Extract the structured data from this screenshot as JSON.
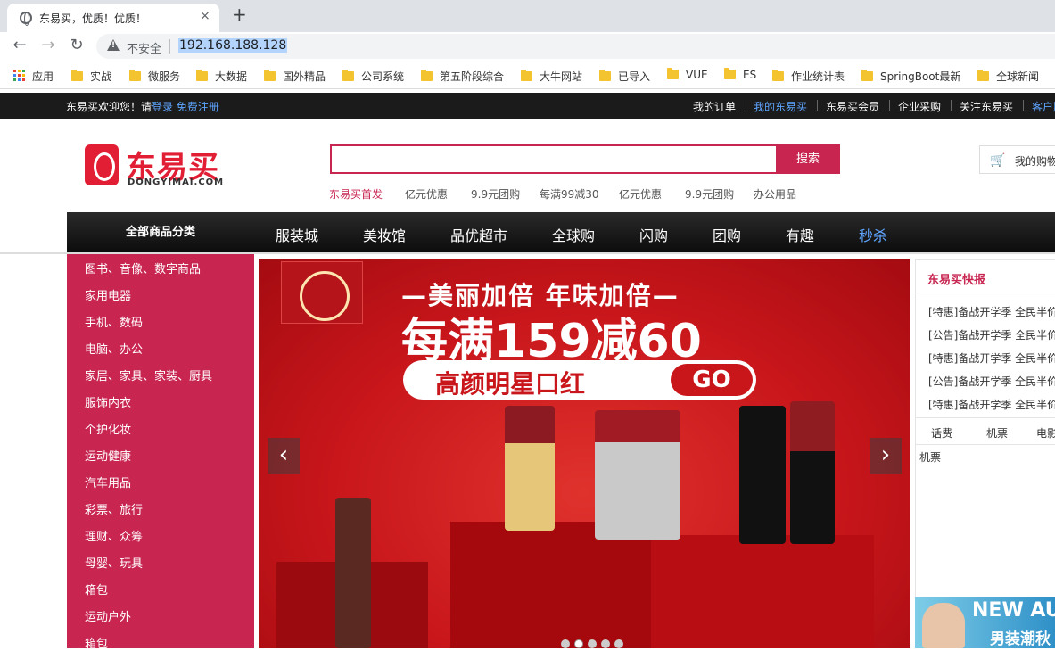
{
  "browser": {
    "tab_title": "东易买，优质！优质！",
    "tab_close": "×",
    "new_tab": "+",
    "insecure_label": "不安全",
    "url": "192.168.188.128",
    "bookmarks": [
      "应用",
      "实战",
      "微服务",
      "大数据",
      "国外精品",
      "公司系统",
      "第五阶段综合",
      "大牛网站",
      "已导入",
      "VUE",
      "ES",
      "作业统计表",
      "SpringBoot最新",
      "全球新闻"
    ]
  },
  "site": {
    "welcome_prefix": "东易买欢迎您！请",
    "login": "登录",
    "register": "免费注册",
    "top_links": [
      "我的订单",
      "我的东易买",
      "东易买会员",
      "企业采购",
      "关注东易买",
      "客户服务"
    ],
    "logo_text": "东易买",
    "logo_sub": "DONGYIMAI.COM",
    "search_placeholder": "",
    "search_button": "搜索",
    "hot_keywords": [
      "东易买首发",
      "亿元优惠",
      "9.9元团购",
      "每满99减30",
      "亿元优惠",
      "9.9元团购",
      "办公用品"
    ],
    "cart_label": "我的购物车",
    "all_categories": "全部商品分类",
    "nav": [
      "服装城",
      "美妆馆",
      "品优超市",
      "全球购",
      "闪购",
      "团购",
      "有趣",
      "秒杀"
    ],
    "categories": [
      "图书、音像、数字商品",
      "家用电器",
      "手机、数码",
      "电脑、办公",
      "家居、家具、家装、厨具",
      "服饰内衣",
      "个护化妆",
      "运动健康",
      "汽车用品",
      "彩票、旅行",
      "理财、众筹",
      "母婴、玩具",
      "箱包",
      "运动户外",
      "箱包"
    ],
    "banner": {
      "slogan": "—美丽加倍 年味加倍—",
      "headline": "每满159减60",
      "pill_text": "高颜明星口红",
      "go": "GO",
      "prev": "‹",
      "next": "›"
    },
    "news_title": "东易买快报",
    "news": [
      "[特惠]备战开学季 全民半价购",
      "[公告]备战开学季 全民半价购",
      "[特惠]备战开学季 全民半价购",
      "[公告]备战开学季 全民半价购",
      "[特惠]备战开学季 全民半价购"
    ],
    "service_tabs": [
      "话费",
      "机票",
      "电影票"
    ],
    "service_content": "机票",
    "ad_line1": "NEW AUTUMN",
    "ad_line2": "男装潮秋"
  },
  "colors": {
    "brand": "#c82551",
    "logo_red": "#e21e35"
  }
}
